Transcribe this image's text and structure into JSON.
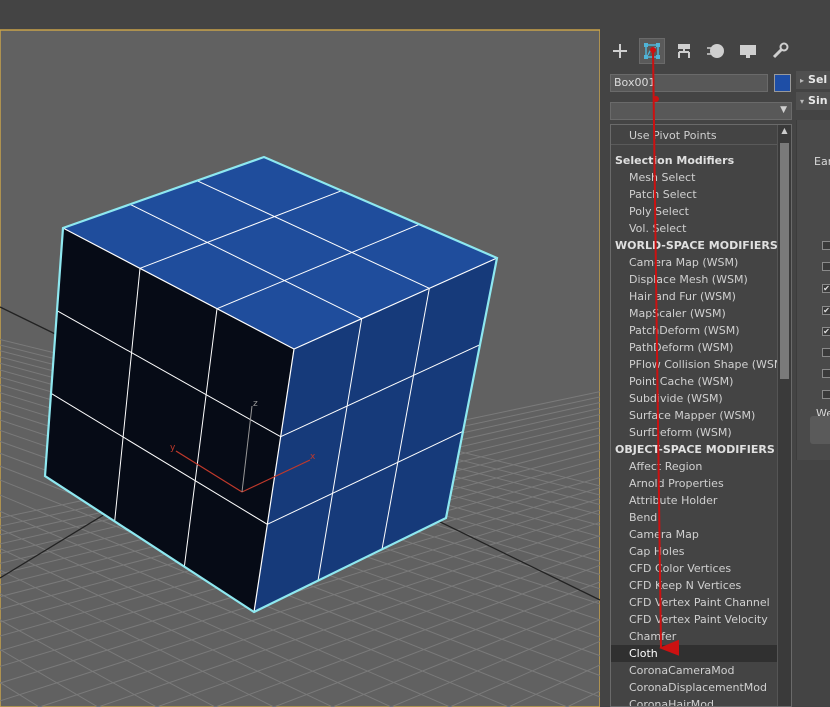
{
  "scene": {
    "gizmo": {
      "x_label": "x",
      "y_label": "y",
      "z_label": "z"
    },
    "colors": {
      "background": "#616161",
      "grid": "#7a7a7a",
      "top_face": "#1f4d9c",
      "front_face": "#060b16",
      "side_face": "#163a7a",
      "edges": "#ffffff",
      "outline": "#8ee8f0",
      "gizmo_axes": "#c0392b",
      "arrow": "#cc1111"
    }
  },
  "command_panel": {
    "tabs": [
      {
        "name": "create",
        "icon": "plus-icon"
      },
      {
        "name": "modify",
        "icon": "modify-icon",
        "active": true
      },
      {
        "name": "hierarchy",
        "icon": "hierarchy-icon"
      },
      {
        "name": "motion",
        "icon": "motion-icon"
      },
      {
        "name": "display",
        "icon": "display-icon"
      },
      {
        "name": "utilities",
        "icon": "wrench-icon"
      }
    ],
    "object_name": "Box001",
    "object_color": "#1e4ea6",
    "modifier_list": {
      "selected_value": "",
      "items": [
        {
          "label": "Use Pivot Points",
          "type": "item"
        },
        {
          "label": "Selection Modifiers",
          "type": "header"
        },
        {
          "label": "Mesh Select",
          "type": "item"
        },
        {
          "label": "Patch Select",
          "type": "item"
        },
        {
          "label": "Poly Select",
          "type": "item"
        },
        {
          "label": "Vol. Select",
          "type": "item"
        },
        {
          "label": "WORLD-SPACE MODIFIERS",
          "type": "header"
        },
        {
          "label": "Camera Map (WSM)",
          "type": "item"
        },
        {
          "label": "Displace Mesh (WSM)",
          "type": "item"
        },
        {
          "label": "Hair and Fur (WSM)",
          "type": "item"
        },
        {
          "label": "MapScaler (WSM)",
          "type": "item"
        },
        {
          "label": "PatchDeform (WSM)",
          "type": "item"
        },
        {
          "label": "PathDeform (WSM)",
          "type": "item"
        },
        {
          "label": "PFlow Collision Shape (WSM)",
          "type": "item"
        },
        {
          "label": "Point Cache (WSM)",
          "type": "item"
        },
        {
          "label": "Subdivide (WSM)",
          "type": "item"
        },
        {
          "label": "Surface Mapper (WSM)",
          "type": "item"
        },
        {
          "label": "SurfDeform (WSM)",
          "type": "item"
        },
        {
          "label": "OBJECT-SPACE MODIFIERS",
          "type": "header"
        },
        {
          "label": "Affect Region",
          "type": "item"
        },
        {
          "label": "Arnold Properties",
          "type": "item"
        },
        {
          "label": "Attribute Holder",
          "type": "item"
        },
        {
          "label": "Bend",
          "type": "item"
        },
        {
          "label": "Camera Map",
          "type": "item"
        },
        {
          "label": "Cap Holes",
          "type": "item"
        },
        {
          "label": "CFD Color Vertices",
          "type": "item"
        },
        {
          "label": "CFD Keep N Vertices",
          "type": "item"
        },
        {
          "label": "CFD Vertex Paint Channel",
          "type": "item"
        },
        {
          "label": "CFD Vertex Paint Velocity",
          "type": "item"
        },
        {
          "label": "Chamfer",
          "type": "item"
        },
        {
          "label": "Cloth",
          "type": "item",
          "selected": true
        },
        {
          "label": "CoronaCameraMod",
          "type": "item"
        },
        {
          "label": "CoronaDisplacementMod",
          "type": "item"
        },
        {
          "label": "CoronaHairMod",
          "type": "item"
        }
      ]
    }
  },
  "right_partial": {
    "rollout1": "Sel",
    "rollout2": "Sin",
    "label_a": "Ear",
    "label_b": "We",
    "checks": [
      false,
      false,
      true,
      true,
      true,
      false,
      false,
      false
    ]
  }
}
